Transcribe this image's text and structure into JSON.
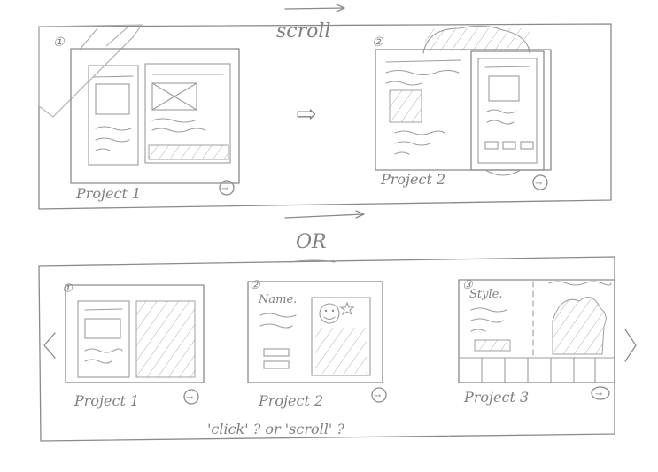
{
  "top_section": {
    "scroll_label": "scroll",
    "frame1": {
      "number": "①",
      "caption": "Project 1",
      "arrow": "→"
    },
    "transition_arrow": "⇨",
    "frame2": {
      "number": "②",
      "caption": "Project 2",
      "arrow": "→"
    }
  },
  "divider": {
    "label": "OR"
  },
  "bottom_section": {
    "cards": [
      {
        "number": "①",
        "caption": "Project 1",
        "arrow": "→"
      },
      {
        "number": "②",
        "heading": "Name.",
        "caption": "Project 2",
        "arrow": "→"
      },
      {
        "number": "③",
        "heading": "Style.",
        "caption": "Project 3",
        "arrow": "→"
      }
    ],
    "prev_arrow": "‹",
    "next_arrow": "›",
    "question": "'click' ? or 'scroll' ?"
  }
}
